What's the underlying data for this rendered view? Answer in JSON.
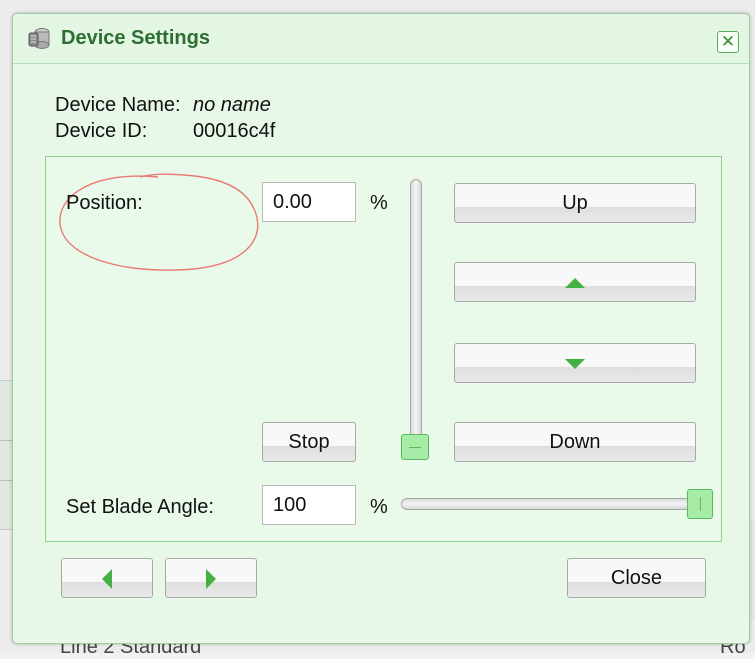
{
  "background": {
    "left_text": "Line 2 Standard",
    "right_text": "Ro"
  },
  "dialog": {
    "title": "Device Settings",
    "title_icon": "device-cylinder-icon",
    "close_glyph": "✕",
    "device_name_label": "Device Name:",
    "device_name_value": "no name",
    "device_id_label": "Device ID:",
    "device_id_value": "00016c4f"
  },
  "controls": {
    "position_label": "Position:",
    "position_value": "0.00",
    "position_unit": "%",
    "position_slider_percent": 0,
    "stop_label": "Stop",
    "up_label": "Up",
    "step_up_icon": "triangle-up-icon",
    "step_down_icon": "triangle-down-icon",
    "down_label": "Down",
    "blade_angle_label": "Set Blade Angle:",
    "blade_angle_value": "100",
    "blade_angle_unit": "%",
    "blade_angle_slider_percent": 100
  },
  "footer": {
    "prev_icon": "triangle-left-icon",
    "next_icon": "triangle-right-icon",
    "close_label": "Close"
  },
  "colors": {
    "accent": "#44b044",
    "title": "#2e6f31",
    "dialog_bg": "#e8f8e8",
    "annotation": "#e87a72"
  }
}
